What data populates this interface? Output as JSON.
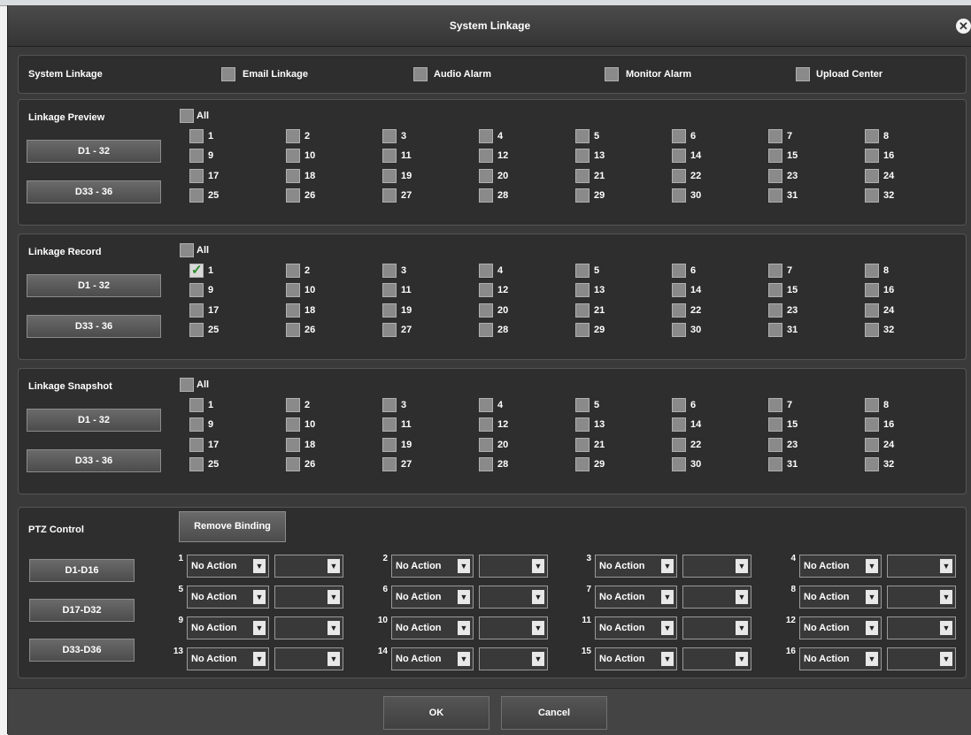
{
  "dialog": {
    "title": "System Linkage"
  },
  "system_linkage": {
    "label": "System Linkage",
    "options": [
      {
        "label": "Email Linkage",
        "checked": false
      },
      {
        "label": "Audio Alarm",
        "checked": false
      },
      {
        "label": "Monitor Alarm",
        "checked": false
      },
      {
        "label": "Upload Center",
        "checked": false
      }
    ]
  },
  "groups": [
    {
      "label": "Linkage Preview",
      "all_label": "All",
      "tabs": [
        "D1 - 32",
        "D33 - 36"
      ],
      "checked": []
    },
    {
      "label": "Linkage Record",
      "all_label": "All",
      "tabs": [
        "D1 - 32",
        "D33 - 36"
      ],
      "checked": [
        1
      ]
    },
    {
      "label": "Linkage Snapshot",
      "all_label": "All",
      "tabs": [
        "D1 - 32",
        "D33 - 36"
      ],
      "checked": []
    }
  ],
  "channels": [
    "1",
    "2",
    "3",
    "4",
    "5",
    "6",
    "7",
    "8",
    "9",
    "10",
    "11",
    "12",
    "13",
    "14",
    "15",
    "16",
    "17",
    "18",
    "19",
    "20",
    "21",
    "22",
    "23",
    "24",
    "25",
    "26",
    "27",
    "28",
    "29",
    "30",
    "31",
    "32"
  ],
  "ptz": {
    "label": "PTZ Control",
    "remove_label": "Remove Binding",
    "tabs": [
      "D1-D16",
      "D17-D32",
      "D33-D36"
    ],
    "action_value": "No Action",
    "second_value": "",
    "numbers": [
      "1",
      "2",
      "3",
      "4",
      "5",
      "6",
      "7",
      "8",
      "9",
      "10",
      "11",
      "12",
      "13",
      "14",
      "15",
      "16"
    ]
  },
  "footer": {
    "ok_label": "OK",
    "cancel_label": "Cancel"
  }
}
